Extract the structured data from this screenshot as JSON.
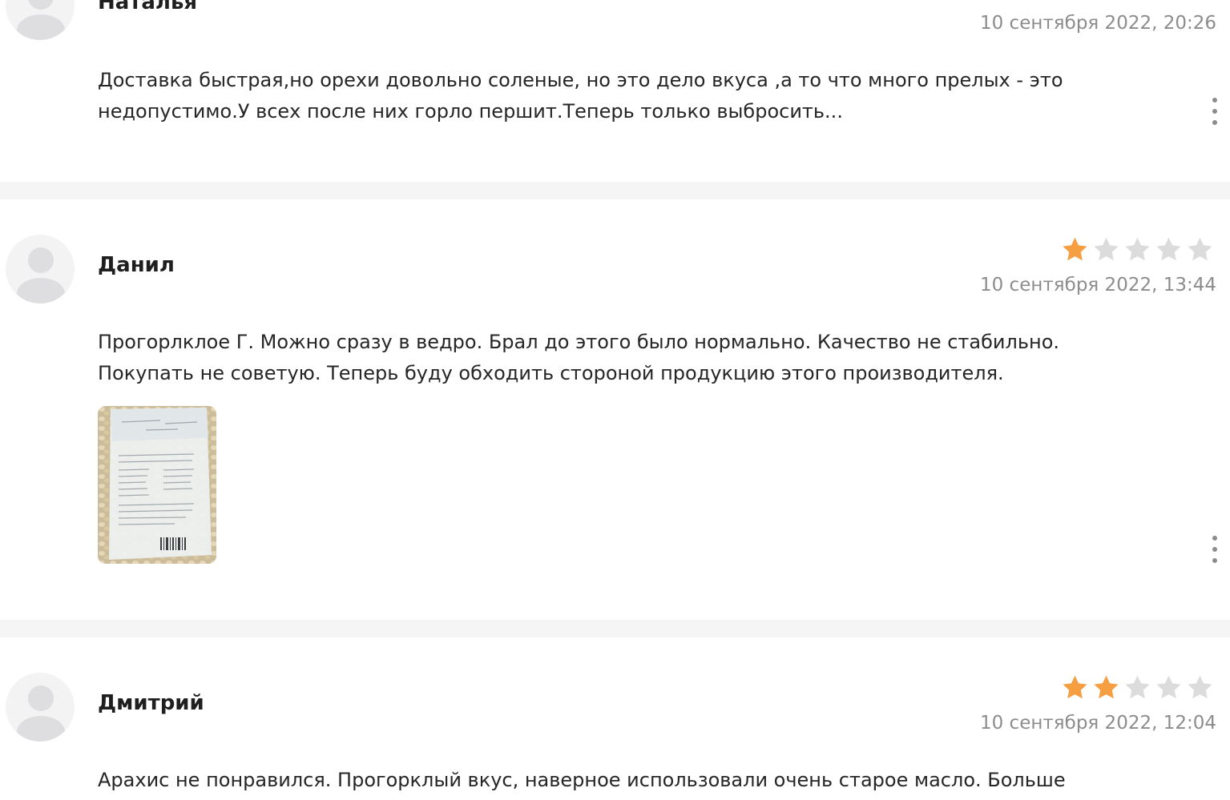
{
  "reviews": [
    {
      "author": "Наталья",
      "date": "10 сентября 2022, 20:26",
      "rating": null,
      "text_lines": [
        "Доставка быстрая,но орехи довольно соленые, но это дело вкуса ,а то что много прелых - это",
        "недопустимо.У всех после них горло першит.Теперь только выбросить..."
      ]
    },
    {
      "author": "Данил",
      "date": "10 сентября 2022, 13:44",
      "rating": 1,
      "rating_max": 5,
      "text_lines": [
        "Прогорлклое Г. Можно сразу в ведро. Брал до этого было нормально. Качество не стабильно.",
        "Покупать не советую. Теперь буду обходить стороной продукцию этого производителя."
      ],
      "photo_count": 1
    },
    {
      "author": "Дмитрий",
      "date": "10 сентября 2022, 12:04",
      "rating": 2,
      "rating_max": 5,
      "text_lines": [
        "Арахис не понравился. Прогорклый вкус, наверное использовали очень старое масло. Больше"
      ]
    }
  ],
  "colors": {
    "star_filled": "#f59e42",
    "star_empty": "#dcdcdc",
    "separator": "#f5f5f6",
    "date_text": "#8c8c8c"
  },
  "icons": {
    "avatar": "user-silhouette-icon",
    "more": "vertical-ellipsis-icon",
    "star": "star-icon"
  }
}
